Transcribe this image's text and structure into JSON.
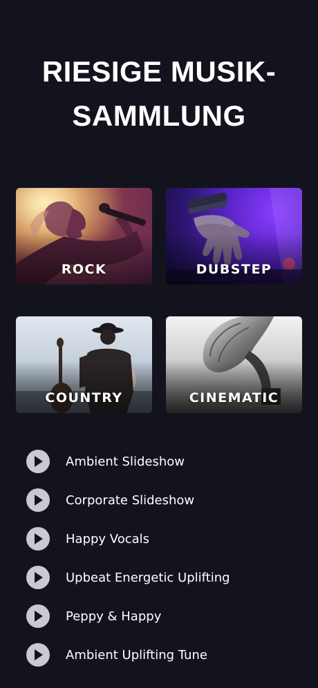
{
  "header": {
    "title_line1": "RIESIGE MUSIK-",
    "title_line2": "SAMMLUNG"
  },
  "genres": [
    {
      "label": "ROCK"
    },
    {
      "label": "DUBSTEP"
    },
    {
      "label": "COUNTRY"
    },
    {
      "label": "CINEMATIC"
    }
  ],
  "tracks": [
    {
      "title": "Ambient Slideshow",
      "icon": "play-icon"
    },
    {
      "title": "Corporate Slideshow",
      "icon": "play-icon"
    },
    {
      "title": "Happy Vocals",
      "icon": "play-icon"
    },
    {
      "title": "Upbeat Energetic Uplifting",
      "icon": "play-icon"
    },
    {
      "title": "Peppy & Happy",
      "icon": "play-icon"
    },
    {
      "title": "Ambient Uplifting Tune",
      "icon": "play-icon"
    }
  ],
  "colors": {
    "background": "#13131e",
    "play_button": "#c9c9cf",
    "play_glyph": "#13131e",
    "text": "#ffffff"
  }
}
